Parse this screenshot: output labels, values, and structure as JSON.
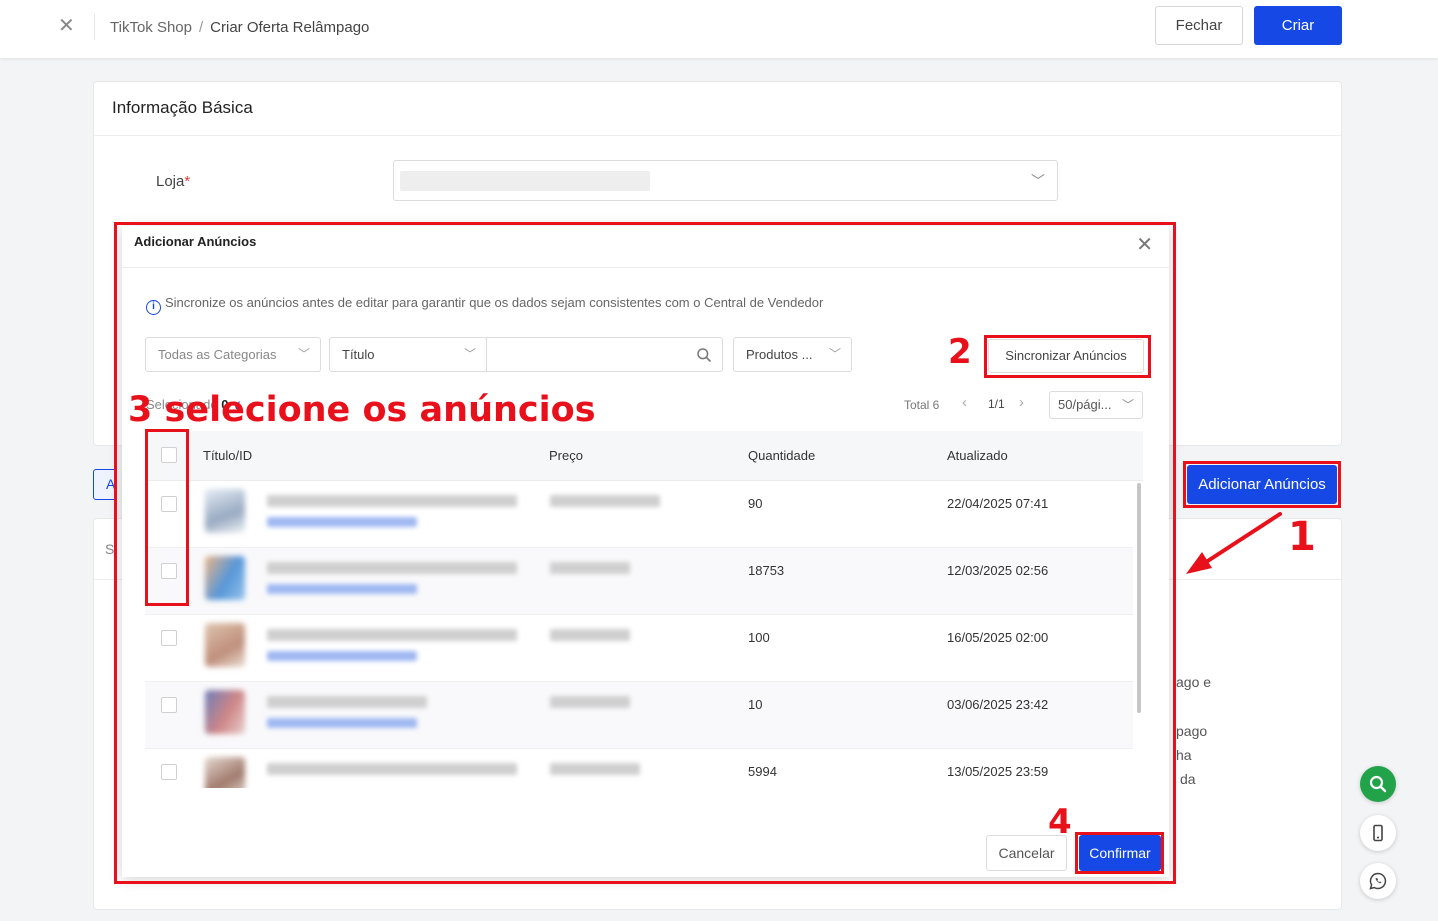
{
  "header": {
    "breadcrumb_root": "TikTok Shop",
    "breadcrumb_sep": "/",
    "breadcrumb_current": "Criar Oferta Relâmpago",
    "close_button": "Fechar",
    "create_button": "Criar"
  },
  "basic_info": {
    "title": "Informação Básica",
    "store_label": "Loja",
    "required_mark": "*"
  },
  "background": {
    "tab_letter": "A",
    "section_letter": "S",
    "add_listings_button": "Adicionar Anúncios",
    "partial_text": [
      "ago e",
      "pago",
      "ha",
      "da"
    ]
  },
  "modal": {
    "title": "Adicionar Anúncios",
    "info_text": "Sincronize os anúncios antes de editar para garantir que os dados sejam consistentes com o Central de Vendedor",
    "filters": {
      "category": "Todas as Categorias",
      "field": "Título",
      "search_placeholder": "",
      "products": "Produtos ..."
    },
    "sync_button": "Sincronizar Anúncios",
    "selected_label": "Selecionado",
    "selected_count": "0",
    "pagination": {
      "total": "Total 6",
      "page": "1/1",
      "page_size": "50/pági..."
    },
    "columns": {
      "title": "Título/ID",
      "price": "Preço",
      "quantity": "Quantidade",
      "updated": "Atualizado"
    },
    "rows": [
      {
        "quantity": "90",
        "updated": "22/04/2025 07:41"
      },
      {
        "quantity": "18753",
        "updated": "12/03/2025 02:56"
      },
      {
        "quantity": "100",
        "updated": "16/05/2025 02:00"
      },
      {
        "quantity": "10",
        "updated": "03/06/2025 23:42"
      },
      {
        "quantity": "5994",
        "updated": "13/05/2025 23:59"
      }
    ],
    "cancel_button": "Cancelar",
    "confirm_button": "Confirmar"
  },
  "annotations": {
    "step1": "1",
    "step2": "2",
    "step3": "3 selecione os anúncios",
    "step4": "4"
  },
  "colors": {
    "primary": "#1648e6",
    "annotation_red": "#e8101b",
    "float_green": "#22a34a"
  },
  "icons": [
    "close-icon",
    "chevron-down-icon",
    "info-icon",
    "search-icon",
    "chevron-left-icon",
    "chevron-right-icon",
    "phone-icon",
    "whatsapp-icon",
    "arrow-icon"
  ]
}
